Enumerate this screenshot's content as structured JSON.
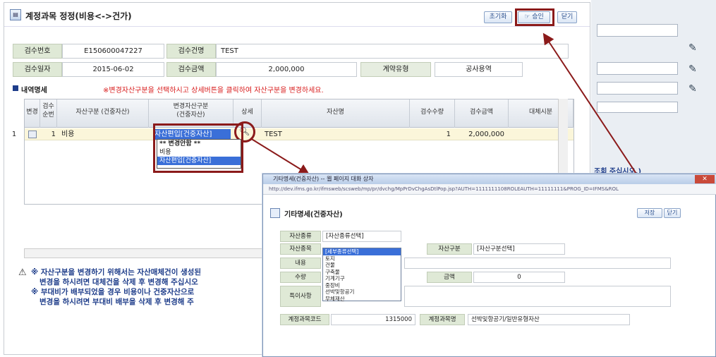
{
  "main": {
    "title": "계정과목 정정(비용<->건가)",
    "buttons": {
      "reset": "초기화",
      "approve": "승인",
      "close": "닫기"
    },
    "form": {
      "inspection_no_label": "검수번호",
      "inspection_no": "E150600047227",
      "inspection_name_label": "검수건명",
      "inspection_name": "TEST",
      "inspection_date_label": "검수일자",
      "inspection_date": "2015-06-02",
      "inspection_amount_label": "검수금액",
      "inspection_amount": "2,000,000",
      "contract_type_label": "계약유형",
      "contract_type": "공사용역"
    },
    "section_title": "내역명세",
    "warning": "※변경자산구분을 선택하시고 상세버튼을 클릭하여 자산구분을 변경하세요.",
    "grid": {
      "headers": [
        "변경",
        "검수\n순번",
        "자산구분 (건중자산)",
        "변경자산구분\n(건중자산)",
        "상세",
        "자산명",
        "검수수량",
        "검수금액",
        "대체시분"
      ],
      "row": {
        "no": "1",
        "seq": "1",
        "asset_class": "비용",
        "change_class": "자산편입[건중자산]",
        "asset_name": "TEST",
        "qty": "1",
        "amount": "2,000,000"
      },
      "dropdown_options": [
        "** 변경안함 **",
        "비용",
        "자산편입[건중자산]"
      ]
    },
    "notes": [
      "※ 자산구분을 변경하기 위해서는 자산매체건이 생성된",
      "변경을 하시려면 대체건을 삭제 후 변경해 주십시오",
      "※ 부대비가 배부되었을 경우 비용이나 건중자산으로",
      "변경을 하시려면 부대비 배부을 삭제 후 변경해 주"
    ]
  },
  "right_panel": {
    "text": "조회 주십시오.)"
  },
  "popup": {
    "window_title": "기타명세(건중자산) -- 웹 페이지 대화 상자",
    "url": "http://dev.ifms.go.kr/ifmsweb/scsweb/mp/pr/dvchg/MpPrDvChgAsDtlPop.jsp?AUTH=1111111108ROLEAUTH=11111111&PROG_ID=IFMS&ROL",
    "title": "기타명세(건중자산)",
    "buttons": {
      "save": "저장",
      "close": "닫기"
    },
    "labels": {
      "asset_kind": "자산종류",
      "asset_type": "자산종목",
      "asset_class": "자산구분",
      "content": "내용",
      "qty": "수량",
      "amount": "금액",
      "special": "특이사항",
      "account_code": "계정과목코드",
      "account_name": "계정과목명"
    },
    "values": {
      "asset_kind": "[자산종류선택]",
      "asset_type": "[세부종류선택]",
      "asset_class": "[자산구분선택]",
      "qty": "",
      "amount": "0",
      "account_code": "1315000",
      "account_name": "선박및항공기/일반유형자산"
    },
    "options": [
      "[세부종류선택]",
      "토지",
      "건물",
      "구축물",
      "기계기구",
      "중장비",
      "선박및항공기",
      "무체재산"
    ]
  },
  "colors": {
    "highlight": "#8b1a1a",
    "label_bg": "#dfe9d6",
    "row_bg": "#fbf6da",
    "accent": "#2e6fd8"
  }
}
